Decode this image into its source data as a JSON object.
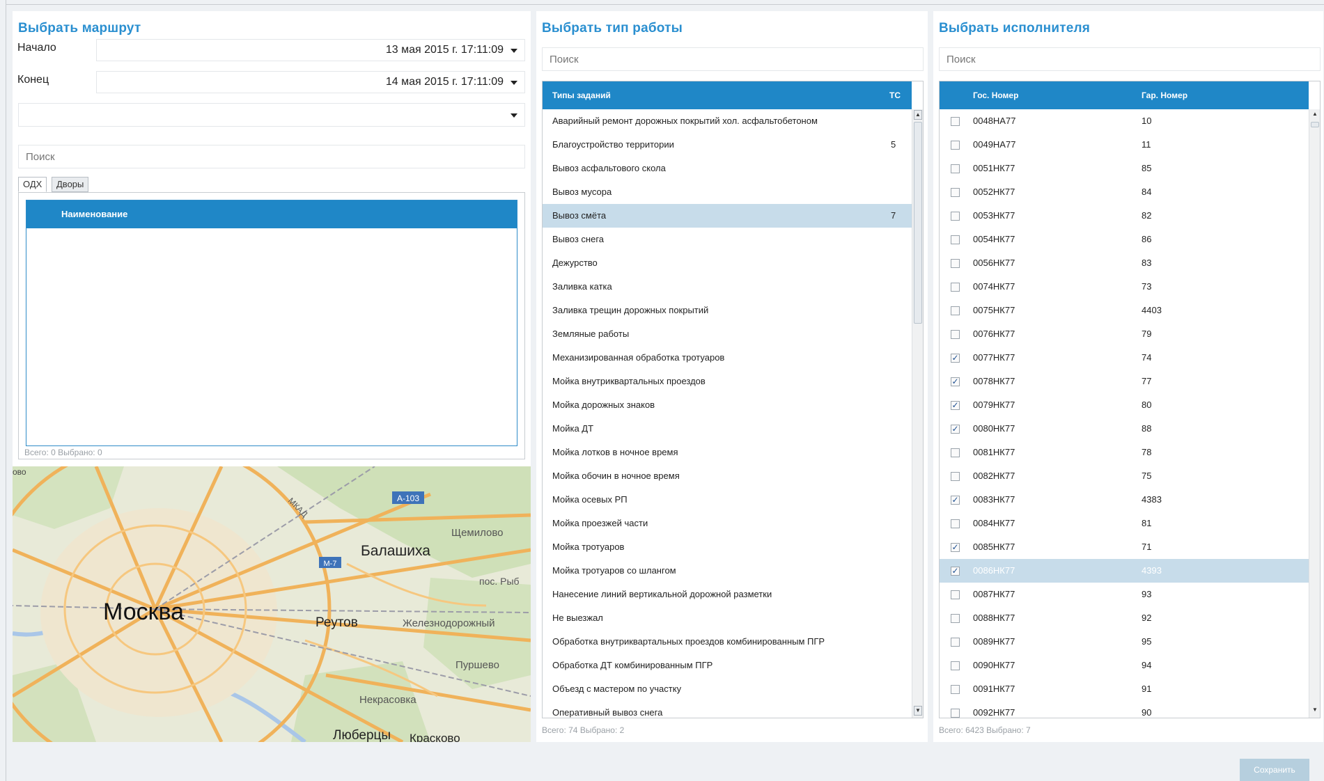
{
  "route": {
    "title": "Выбрать маршрут",
    "start_label": "Начало",
    "start_value": "13 мая 2015 г. 17:11:09",
    "end_label": "Конец",
    "end_value": "14 мая 2015 г. 17:11:09",
    "select_value": "",
    "search_placeholder": "Поиск",
    "tabs": [
      "ОДХ",
      "Дворы"
    ],
    "list_header": "Наименование",
    "footer": "Всего: 0 Выбрано: 0"
  },
  "map": {
    "labels": {
      "moscow": "Москва",
      "balashikha": "Балашиха",
      "reutov": "Реутов",
      "zheleznodorozhny": "Железнодорожный",
      "shchemilovo": "Щемилово",
      "pos_ryb": "пос. Рыб",
      "purshevo": "Пуршево",
      "nekrasovka": "Некрасовка",
      "lyubertsy": "Люберцы",
      "kraskovo": "Красково",
      "mkad": "МКАД",
      "a103": "А-103",
      "m7": "М-7",
      "partial": "ово"
    }
  },
  "work_types": {
    "title": "Выбрать тип работы",
    "search_placeholder": "Поиск",
    "col_name": "Типы заданий",
    "col_count": "ТС",
    "rows": [
      {
        "name": "Аварийный ремонт дорожных покрытий хол. асфальтобетоном",
        "count": "",
        "selected": false
      },
      {
        "name": "Благоустройство территории",
        "count": "5",
        "selected": false
      },
      {
        "name": "Вывоз асфальтового скола",
        "count": "",
        "selected": false
      },
      {
        "name": "Вывоз мусора",
        "count": "",
        "selected": false
      },
      {
        "name": "Вывоз смёта",
        "count": "7",
        "selected": true
      },
      {
        "name": "Вывоз снега",
        "count": "",
        "selected": false
      },
      {
        "name": "Дежурство",
        "count": "",
        "selected": false
      },
      {
        "name": "Заливка катка",
        "count": "",
        "selected": false
      },
      {
        "name": "Заливка трещин дорожных покрытий",
        "count": "",
        "selected": false
      },
      {
        "name": "Земляные работы",
        "count": "",
        "selected": false
      },
      {
        "name": "Механизированная обработка тротуаров",
        "count": "",
        "selected": false
      },
      {
        "name": "Мойка внутриквартальных проездов",
        "count": "",
        "selected": false
      },
      {
        "name": "Мойка дорожных знаков",
        "count": "",
        "selected": false
      },
      {
        "name": "Мойка ДТ",
        "count": "",
        "selected": false
      },
      {
        "name": "Мойка лотков в ночное время",
        "count": "",
        "selected": false
      },
      {
        "name": "Мойка обочин в ночное время",
        "count": "",
        "selected": false
      },
      {
        "name": "Мойка осевых РП",
        "count": "",
        "selected": false
      },
      {
        "name": "Мойка проезжей части",
        "count": "",
        "selected": false
      },
      {
        "name": "Мойка тротуаров",
        "count": "",
        "selected": false
      },
      {
        "name": "Мойка тротуаров со шлангом",
        "count": "",
        "selected": false
      },
      {
        "name": "Нанесение линий вертикальной дорожной разметки",
        "count": "",
        "selected": false
      },
      {
        "name": "Не выезжал",
        "count": "",
        "selected": false
      },
      {
        "name": "Обработка внутриквартальных проездов комбинированным ПГР",
        "count": "",
        "selected": false
      },
      {
        "name": "Обработка ДТ комбинированным ПГР",
        "count": "",
        "selected": false
      },
      {
        "name": "Объезд с мастером по участку",
        "count": "",
        "selected": false
      },
      {
        "name": "Оперативный вывоз снега",
        "count": "",
        "selected": false
      }
    ],
    "footer": "Всего: 74 Выбрано: 2"
  },
  "executors": {
    "title": "Выбрать исполнителя",
    "search_placeholder": "Поиск",
    "col_gos": "Гос. Номер",
    "col_gar": "Гар. Номер",
    "rows": [
      {
        "gos": "0048НА77",
        "gar": "10",
        "checked": false,
        "highlight": false
      },
      {
        "gos": "0049НА77",
        "gar": "11",
        "checked": false,
        "highlight": false
      },
      {
        "gos": "0051НК77",
        "gar": "85",
        "checked": false,
        "highlight": false
      },
      {
        "gos": "0052НК77",
        "gar": "84",
        "checked": false,
        "highlight": false
      },
      {
        "gos": "0053НК77",
        "gar": "82",
        "checked": false,
        "highlight": false
      },
      {
        "gos": "0054НК77",
        "gar": "86",
        "checked": false,
        "highlight": false
      },
      {
        "gos": "0056НК77",
        "gar": "83",
        "checked": false,
        "highlight": false
      },
      {
        "gos": "0074НК77",
        "gar": "73",
        "checked": false,
        "highlight": false
      },
      {
        "gos": "0075НК77",
        "gar": "4403",
        "checked": false,
        "highlight": false
      },
      {
        "gos": "0076НК77",
        "gar": "79",
        "checked": false,
        "highlight": false
      },
      {
        "gos": "0077НК77",
        "gar": "74",
        "checked": true,
        "highlight": false
      },
      {
        "gos": "0078НК77",
        "gar": "77",
        "checked": true,
        "highlight": false
      },
      {
        "gos": "0079НК77",
        "gar": "80",
        "checked": true,
        "highlight": false
      },
      {
        "gos": "0080НК77",
        "gar": "88",
        "checked": true,
        "highlight": false
      },
      {
        "gos": "0081НК77",
        "gar": "78",
        "checked": false,
        "highlight": false
      },
      {
        "gos": "0082НК77",
        "gar": "75",
        "checked": false,
        "highlight": false
      },
      {
        "gos": "0083НК77",
        "gar": "4383",
        "checked": true,
        "highlight": false
      },
      {
        "gos": "0084НК77",
        "gar": "81",
        "checked": false,
        "highlight": false
      },
      {
        "gos": "0085НК77",
        "gar": "71",
        "checked": true,
        "highlight": false
      },
      {
        "gos": "0086НК77",
        "gar": "4393",
        "checked": true,
        "highlight": true
      },
      {
        "gos": "0087НК77",
        "gar": "93",
        "checked": false,
        "highlight": false
      },
      {
        "gos": "0088НК77",
        "gar": "92",
        "checked": false,
        "highlight": false
      },
      {
        "gos": "0089НК77",
        "gar": "95",
        "checked": false,
        "highlight": false
      },
      {
        "gos": "0090НК77",
        "gar": "94",
        "checked": false,
        "highlight": false
      },
      {
        "gos": "0091НК77",
        "gar": "91",
        "checked": false,
        "highlight": false
      },
      {
        "gos": "0092НК77",
        "gar": "90",
        "checked": false,
        "highlight": false
      }
    ],
    "footer": "Всего: 6423 Выбрано: 7"
  },
  "save_label": "Сохранить",
  "colors": {
    "accent": "#1f87c7",
    "title": "#2a8fd0",
    "selected_row": "#c7dcea"
  }
}
